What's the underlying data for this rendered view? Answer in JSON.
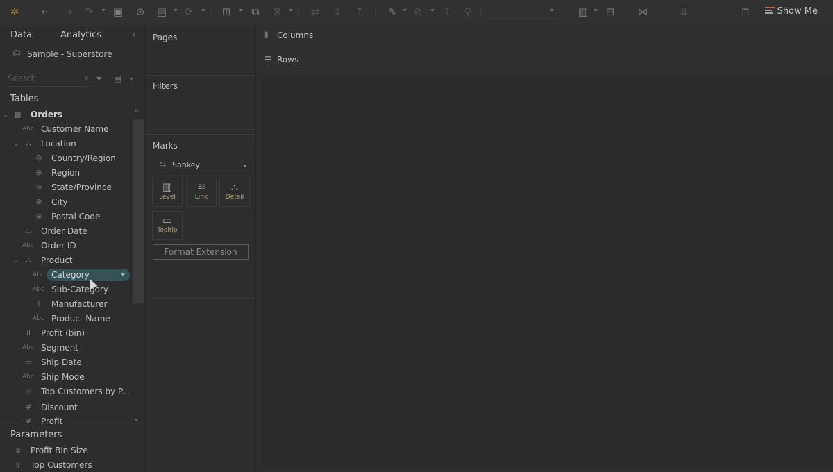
{
  "toolbar": {
    "show_me_label": "Show Me"
  },
  "sidebar": {
    "tabs": {
      "data": "Data",
      "analytics": "Analytics"
    },
    "datasource": "Sample - Superstore",
    "search_placeholder": "Search",
    "tables_header": "Tables",
    "table_name": "Orders",
    "fields": [
      {
        "label": "Customer Name",
        "type": "Abc"
      },
      {
        "label": "Location",
        "type": "hierarchy"
      },
      {
        "label": "Country/Region",
        "type": "geo"
      },
      {
        "label": "Region",
        "type": "geo"
      },
      {
        "label": "State/Province",
        "type": "geo"
      },
      {
        "label": "City",
        "type": "geo"
      },
      {
        "label": "Postal Code",
        "type": "geo"
      },
      {
        "label": "Order Date",
        "type": "date"
      },
      {
        "label": "Order ID",
        "type": "Abc"
      },
      {
        "label": "Product",
        "type": "hierarchy"
      },
      {
        "label": "Category",
        "type": "Abc"
      },
      {
        "label": "Sub-Category",
        "type": "Abc"
      },
      {
        "label": "Manufacturer",
        "type": "clip"
      },
      {
        "label": "Product Name",
        "type": "Abc"
      },
      {
        "label": "Profit (bin)",
        "type": "bin"
      },
      {
        "label": "Segment",
        "type": "Abc"
      },
      {
        "label": "Ship Date",
        "type": "date"
      },
      {
        "label": "Ship Mode",
        "type": "Abc"
      },
      {
        "label": "Top Customers by P...",
        "type": "set"
      },
      {
        "label": "Discount",
        "type": "#"
      },
      {
        "label": "Profit",
        "type": "#"
      }
    ],
    "parameters_header": "Parameters",
    "parameters": [
      {
        "label": "Profit Bin Size",
        "type": "#"
      },
      {
        "label": "Top Customers",
        "type": "#"
      }
    ]
  },
  "shelves": {
    "pages": "Pages",
    "filters": "Filters",
    "marks": "Marks",
    "mark_type": "Sankey",
    "mark_buttons": [
      {
        "label": "Level",
        "icon": "level-icon"
      },
      {
        "label": "Link",
        "icon": "link-icon"
      },
      {
        "label": "Detail",
        "icon": "detail-icon"
      },
      {
        "label": "Tooltip",
        "icon": "tooltip-icon"
      }
    ],
    "format_extension": "Format Extension"
  },
  "canvas": {
    "columns": "Columns",
    "rows": "Rows"
  },
  "colors": {
    "selected_pill": "#355357",
    "background": "#2f2f2f"
  }
}
